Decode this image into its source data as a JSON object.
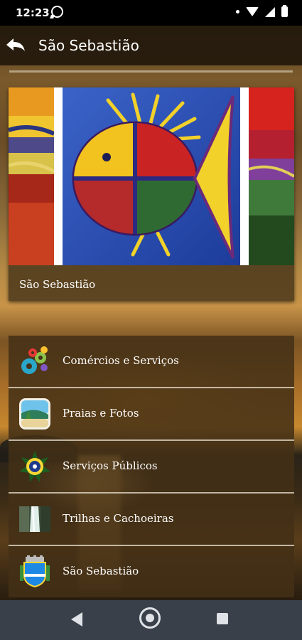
{
  "status_bar": {
    "time": "12:23",
    "icons": [
      "whatsapp-icon",
      "notification-dot-icon",
      "wifi-icon",
      "signal-icon",
      "battery-icon"
    ]
  },
  "app_bar": {
    "title": "São Sebastião",
    "back_icon": "back-arrow-icon"
  },
  "hero": {
    "image_description_icon": "fish-painting-image",
    "title": "São Sebastião"
  },
  "menu": {
    "items": [
      {
        "label": "Comércios e Serviços",
        "icon": "gears-icon"
      },
      {
        "label": "Praias e Fotos",
        "icon": "beach-photo-icon"
      },
      {
        "label": "Serviços Públicos",
        "icon": "brazil-coat-of-arms-icon"
      },
      {
        "label": "Trilhas e Cachoeiras",
        "icon": "waterfall-icon"
      },
      {
        "label": "São Sebastião",
        "icon": "city-coat-of-arms-icon"
      }
    ]
  },
  "nav_bar": {
    "icons": [
      "nav-back-icon",
      "nav-home-icon",
      "nav-recent-apps-icon"
    ]
  },
  "colors": {
    "app_bar": "#231a0c",
    "card": "#4e3a1c",
    "nav_bar": "#3a4049",
    "text": "#ffffff"
  }
}
